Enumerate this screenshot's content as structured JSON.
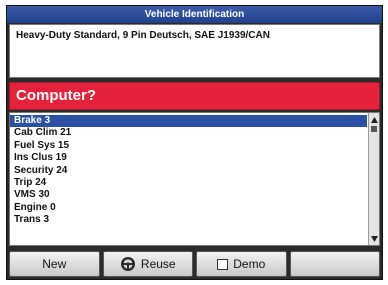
{
  "window": {
    "title": "Vehicle Identification"
  },
  "vehicle_info": "Heavy-Duty Standard, 9 Pin Deutsch, SAE J1939/CAN",
  "prompt": "Computer?",
  "list": {
    "items": [
      {
        "label": "Brake  3",
        "selected": true
      },
      {
        "label": "Cab Clim  21",
        "selected": false
      },
      {
        "label": "Fuel Sys  15",
        "selected": false
      },
      {
        "label": "Ins Clus  19",
        "selected": false
      },
      {
        "label": "Security  24",
        "selected": false
      },
      {
        "label": "Trip  24",
        "selected": false
      },
      {
        "label": "VMS  30",
        "selected": false
      },
      {
        "label": "Engine 0",
        "selected": false
      },
      {
        "label": "Trans 3",
        "selected": false
      }
    ]
  },
  "buttons": {
    "new_label": "New",
    "reuse_label": "Reuse",
    "reuse_icon": "steering-wheel-icon",
    "demo_label": "Demo",
    "demo_checked": false,
    "blank_label": ""
  },
  "colors": {
    "title_bar": "#22428d",
    "prompt_bar": "#e5223b",
    "selection": "#2b4fa2"
  }
}
